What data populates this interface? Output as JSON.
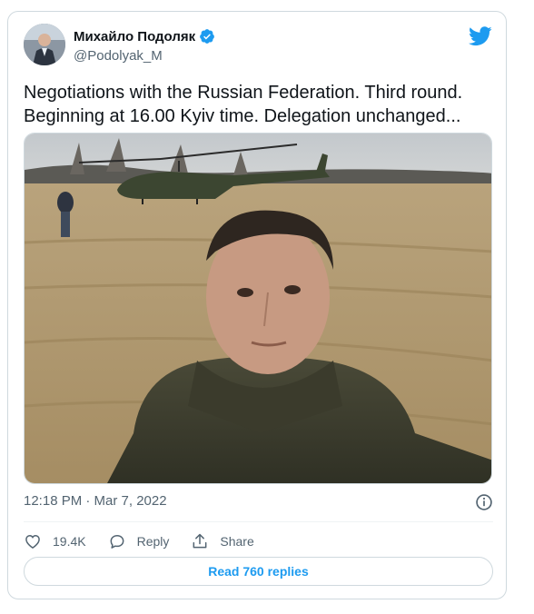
{
  "author": {
    "name": "Михайло Подоляк",
    "handle": "@Podolyak_M",
    "verified": true
  },
  "tweet": {
    "text": "Negotiations with the Russian Federation. Third round. Beginning at 16.00 Kyiv time. Delegation unchanged...",
    "timestamp": "12:18 PM · Mar 7, 2022"
  },
  "actions": {
    "likes": "19.4K",
    "reply_label": "Reply",
    "share_label": "Share"
  },
  "read_replies_label": "Read 760 replies",
  "colors": {
    "accent": "#1d9bf0",
    "secondary_text": "#536471",
    "border": "#cfd9de"
  },
  "icons": [
    "twitter-bird-icon",
    "verified-badge-icon",
    "info-icon",
    "heart-icon",
    "reply-bubble-icon",
    "share-icon"
  ]
}
